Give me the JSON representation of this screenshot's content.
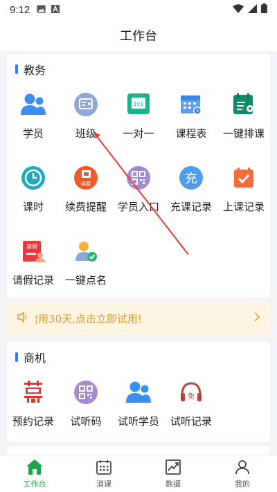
{
  "status_bar": {
    "time": "9:12"
  },
  "header": {
    "title": "工作台"
  },
  "section_jiaowu": {
    "title": "教务",
    "items": [
      {
        "label": "学员",
        "icon": "students-icon"
      },
      {
        "label": "班级",
        "icon": "class-icon"
      },
      {
        "label": "一对一",
        "icon": "one-to-one-icon"
      },
      {
        "label": "课程表",
        "icon": "schedule-icon"
      },
      {
        "label": "一键排课",
        "icon": "auto-schedule-icon"
      },
      {
        "label": "课时",
        "icon": "clock-icon"
      },
      {
        "label": "续费提醒",
        "icon": "renewal-icon"
      },
      {
        "label": "学员入口",
        "icon": "qr-code-icon"
      },
      {
        "label": "充课记录",
        "icon": "recharge-icon"
      },
      {
        "label": "上课记录",
        "icon": "calendar-check-icon"
      },
      {
        "label": "请假记录",
        "icon": "leave-icon"
      },
      {
        "label": "一键点名",
        "icon": "roll-call-icon"
      }
    ]
  },
  "banner": {
    "text": "¦用30天,点击立即试用!"
  },
  "section_shangji": {
    "title": "商机",
    "items": [
      {
        "label": "预约记录",
        "icon": "appointment-icon"
      },
      {
        "label": "试听码",
        "icon": "trial-qr-icon"
      },
      {
        "label": "试听学员",
        "icon": "trial-students-icon"
      },
      {
        "label": "试听记录",
        "icon": "trial-record-icon"
      }
    ]
  },
  "icon_texts": {
    "one_to_one": "1v1",
    "renewal": "续费",
    "recharge": "充",
    "leave": "请假",
    "trial": "免"
  },
  "tabbar": [
    {
      "label": "工作台",
      "active": true
    },
    {
      "label": "消课",
      "active": false
    },
    {
      "label": "数据",
      "active": false
    },
    {
      "label": "我的",
      "active": false
    }
  ],
  "colors": {
    "accent_blue": "#2f7df6",
    "active_green": "#1aa64b",
    "banner_text": "#e29a35",
    "banner_bg": "#fdf4e3",
    "annotation_red": "#e53935"
  }
}
